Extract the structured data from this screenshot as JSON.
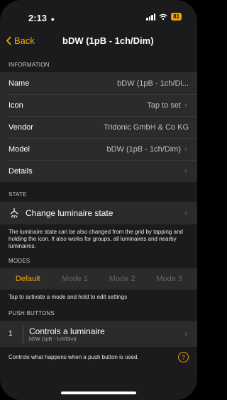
{
  "status_bar": {
    "time": "2:13",
    "battery": "81"
  },
  "nav": {
    "back_label": "Back",
    "title": "bDW (1pB - 1ch/Dim)"
  },
  "information": {
    "header": "INFORMATION",
    "rows": [
      {
        "label": "Name",
        "value": "bDW (1pB - 1ch/Di..."
      },
      {
        "label": "Icon",
        "value": "Tap to set"
      },
      {
        "label": "Vendor",
        "value": "Tridonic GmbH & Co KG"
      },
      {
        "label": "Model",
        "value": "bDW (1pB - 1ch/Dim)"
      },
      {
        "label": "Details",
        "value": ""
      }
    ]
  },
  "state": {
    "header": "STATE",
    "row_label": "Change luminaire state",
    "note": "The luminaire state can be also changed from the grid by tapping and holding the icon. It also works for groups, all luminaires and nearby luminaires."
  },
  "modes": {
    "header": "MODES",
    "items": [
      "Default",
      "Mode 1",
      "Mode 2",
      "Mode 3"
    ],
    "note": "Tap to activate a mode and hold to edit settings"
  },
  "push_buttons": {
    "header": "PUSH BUTTONS",
    "items": [
      {
        "number": "1",
        "title": "Controls a luminaire",
        "subtitle": "bDW (1pB - 1ch/Dim)"
      }
    ],
    "note": "Controls what happens when a push button is used.",
    "help": "?"
  }
}
